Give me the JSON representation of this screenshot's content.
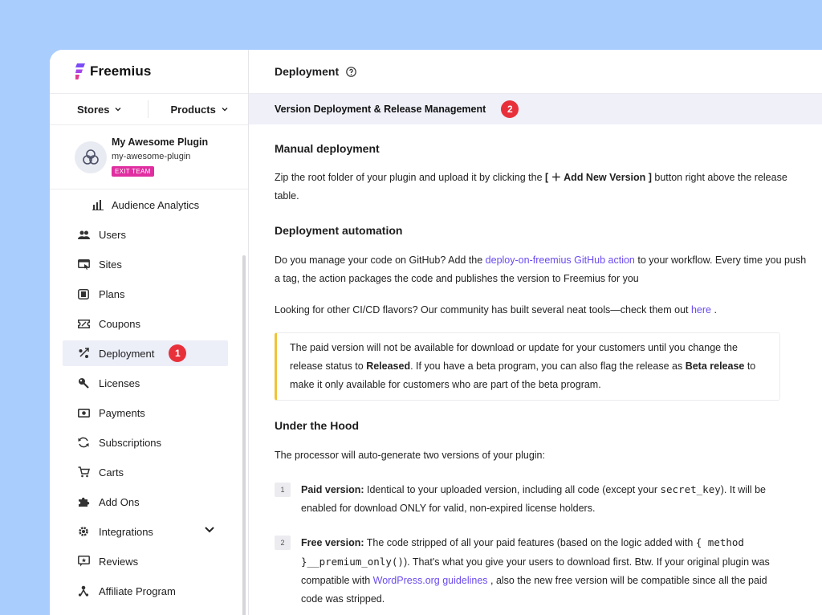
{
  "brand": {
    "name": "Freemius",
    "colors": {
      "accent": "#6b4bf0",
      "badge_red": "#e8303b",
      "exit_badge": "#e02ea0",
      "note_border": "#f0c23a"
    }
  },
  "switchers": {
    "stores": "Stores",
    "products": "Products"
  },
  "plugin": {
    "name": "My Awesome Plugin",
    "slug": "my-awesome-plugin",
    "badge": "EXIT TEAM"
  },
  "nav": {
    "items": [
      {
        "label": "Audience Analytics",
        "icon": "audience-analytics-icon"
      },
      {
        "label": "Users",
        "icon": "users-icon"
      },
      {
        "label": "Sites",
        "icon": "sites-icon"
      },
      {
        "label": "Plans",
        "icon": "plans-icon"
      },
      {
        "label": "Coupons",
        "icon": "coupons-icon"
      },
      {
        "label": "Deployment",
        "icon": "deployment-icon",
        "active": true,
        "badge": "1"
      },
      {
        "label": "Licenses",
        "icon": "licenses-icon"
      },
      {
        "label": "Payments",
        "icon": "payments-icon"
      },
      {
        "label": "Subscriptions",
        "icon": "subscriptions-icon"
      },
      {
        "label": "Carts",
        "icon": "carts-icon"
      },
      {
        "label": "Add Ons",
        "icon": "add-ons-icon"
      },
      {
        "label": "Integrations",
        "icon": "integrations-icon"
      },
      {
        "label": "Reviews",
        "icon": "reviews-icon"
      },
      {
        "label": "Affiliate Program",
        "icon": "affiliate-program-icon"
      }
    ]
  },
  "header": {
    "title": "Deployment"
  },
  "section": {
    "title": "Version Deployment & Release Management",
    "badge": "2"
  },
  "manual": {
    "heading": "Manual deployment",
    "text_before": "Zip the root folder of your plugin and upload it by clicking the ",
    "button_ref": "[ ＋ Add New Version ]",
    "text_after": " button right above the release table."
  },
  "automation": {
    "heading": "Deployment automation",
    "p1_before": "Do you manage your code on GitHub? Add the ",
    "p1_link": "deploy-on-freemius GitHub action",
    "p1_after": " to your workflow. Every time you push a tag, the action packages the code and publishes the version to Freemius for you",
    "p2_before": "Looking for other CI/CD flavors? Our community has built several neat tools—check them out ",
    "p2_link": "here",
    "p2_after": " ."
  },
  "note": {
    "t1": "The paid version will not be available for download or update for your customers until you change the release status to ",
    "b1": "Released",
    "t2": ". If you have a beta program, you can also flag the release as ",
    "b2": "Beta release",
    "t3": " to make it only available for customers who are part of the beta program."
  },
  "hood": {
    "heading": "Under the Hood",
    "intro": "The processor will auto-generate two versions of your plugin:",
    "step1": {
      "num": "1",
      "label": "Paid version:",
      "t1": " Identical to your uploaded version, including all code (except your ",
      "code": "secret_key",
      "t2": "). It will be enabled for download ONLY for valid, non-expired license holders."
    },
    "step2": {
      "num": "2",
      "label": "Free version:",
      "t1": " The code stripped of all your paid features (based on the logic added with ",
      "code": "{ method }__premium_only()",
      "t2": "). That's what you give your users to download first. Btw. If your original plugin was compatible with ",
      "link": "WordPress.org guidelines",
      "t3": " , also the new free version will be compatible since all the paid code was stripped."
    }
  }
}
